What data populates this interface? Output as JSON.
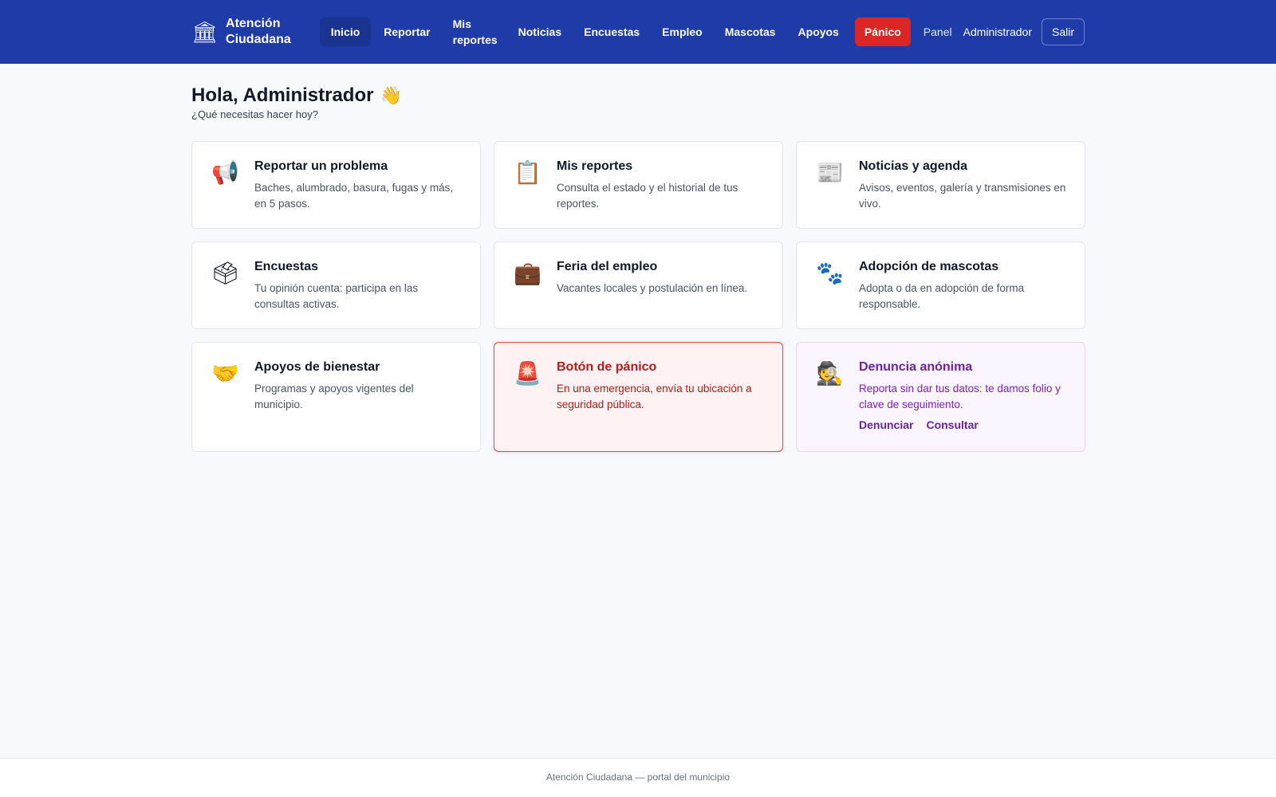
{
  "header": {
    "brand_icon": "🏛",
    "brand_name": "Atención Ciudadana",
    "nav": [
      {
        "label": "Inicio",
        "name": "inicio"
      },
      {
        "label": "Reportar",
        "name": "reportar"
      },
      {
        "label": "Mis reportes",
        "name": "mis-reportes"
      },
      {
        "label": "Noticias",
        "name": "noticias"
      },
      {
        "label": "Encuestas",
        "name": "encuestas"
      },
      {
        "label": "Empleo",
        "name": "empleo"
      },
      {
        "label": "Mascotas",
        "name": "mascotas"
      },
      {
        "label": "Apoyos",
        "name": "apoyos"
      }
    ],
    "panic_label": "Pánico",
    "panel_label": "Panel",
    "user_name": "Administrador",
    "logout_label": "Salir"
  },
  "main": {
    "greeting": "Hola, Administrador",
    "greeting_emoji": "👋",
    "subtitle": "¿Qué necesitas hacer hoy?",
    "cards": [
      {
        "icon": "📢",
        "icon_name": "megaphone-icon",
        "title": "Reportar un problema",
        "desc": "Baches, alumbrado, basura, fugas y más, en 5 pasos."
      },
      {
        "icon": "📋",
        "icon_name": "clipboard-icon",
        "title": "Mis reportes",
        "desc": "Consulta el estado y el historial de tus reportes."
      },
      {
        "icon": "📰",
        "icon_name": "newspaper-icon",
        "title": "Noticias y agenda",
        "desc": "Avisos, eventos, galería y transmisiones en vivo."
      },
      {
        "icon": "🗳",
        "icon_name": "ballot-box-icon",
        "title": "Encuestas",
        "desc": "Tu opinión cuenta: participa en las consultas activas."
      },
      {
        "icon": "💼",
        "icon_name": "briefcase-icon",
        "title": "Feria del empleo",
        "desc": "Vacantes locales y postulación en línea."
      },
      {
        "icon": "🐾",
        "icon_name": "paw-prints-icon",
        "title": "Adopción de mascotas",
        "desc": "Adopta o da en adopción de forma responsable."
      },
      {
        "icon": "🤝",
        "icon_name": "handshake-icon",
        "title": "Apoyos de bienestar",
        "desc": "Programas y apoyos vigentes del municipio."
      },
      {
        "icon": "🚨",
        "icon_name": "siren-icon",
        "title": "Botón de pánico",
        "desc": "En una emergencia, envía tu ubicación a seguridad pública."
      },
      {
        "icon": "🕵",
        "icon_name": "detective-icon",
        "title": "Denuncia anónima",
        "desc": "Reporta sin dar tus datos: te damos folio y clave de seguimiento.",
        "links": [
          "Denunciar",
          "Consultar"
        ]
      }
    ]
  },
  "footer": {
    "text": "Atención Ciudadana — portal del municipio"
  },
  "colors": {
    "header_bg": "#1e3ba8",
    "panic": "#dc2626",
    "anon_accent": "#6b21a8",
    "page_bg": "#f8f9fc"
  }
}
